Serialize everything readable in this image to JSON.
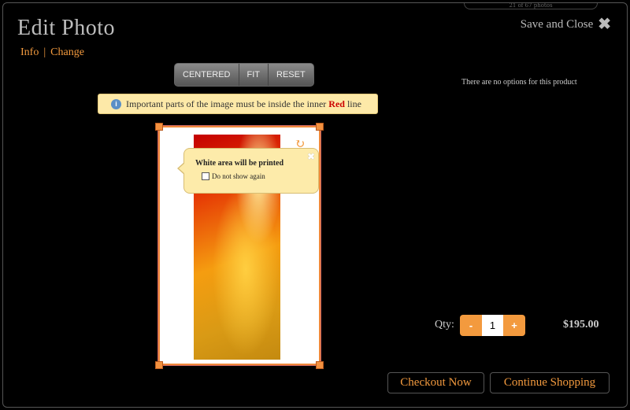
{
  "top_hint": "21 of 67 photos",
  "header": {
    "title": "Edit Photo",
    "save_close_label": "Save and Close"
  },
  "subnav": {
    "info": "Info",
    "separator": "|",
    "change": "Change"
  },
  "toolbar": {
    "centered": "CENTERED",
    "fit": "FIT",
    "reset": "RESET"
  },
  "notice": {
    "before": "Important parts of the image must be inside the inner ",
    "highlight": "Red",
    "after": " line"
  },
  "tooltip": {
    "title": "White area will be printed",
    "checkbox_label": "Do not show again",
    "checked": false
  },
  "options": {
    "message": "There are no options for this product"
  },
  "quantity": {
    "label": "Qty:",
    "minus": "-",
    "value": "1",
    "plus": "+"
  },
  "price": "$195.00",
  "actions": {
    "checkout": "Checkout Now",
    "continue": "Continue Shopping"
  },
  "colors": {
    "accent": "#f39a3e",
    "notice_bg": "#fde9a8",
    "highlight_red": "#cc0000"
  }
}
